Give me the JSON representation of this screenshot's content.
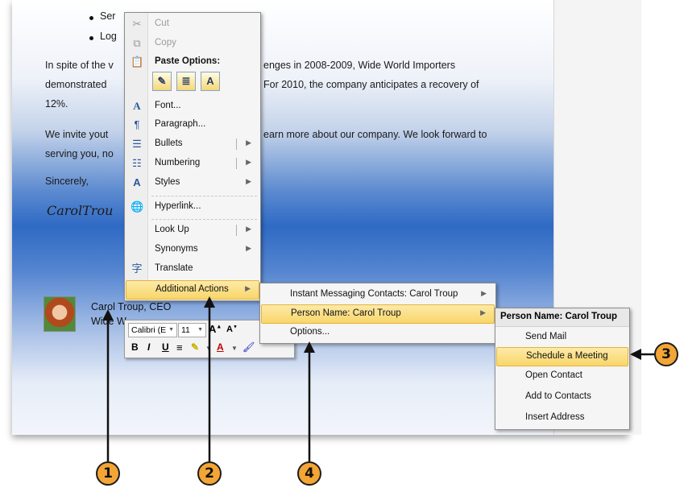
{
  "document": {
    "bullets": [
      "Ser",
      "Log"
    ],
    "para1_line1": "In spite of the v",
    "para1_line1_right": "enges in 2008-2009,  Wide World Importers",
    "para1_line2": "demonstrated",
    "para1_line2_right": "For 2010,  the company anticipates a recovery of",
    "para1_line3": "12%.",
    "para2_line1": "We invite yout",
    "para2_line1_right": "earn more about our company. We look forward to",
    "para2_line2": "serving you, no",
    "closing": "Sincerely,",
    "signature": "CarolTrou",
    "sender_name": "Carol Troup, CEO",
    "sender_company": "Wide W"
  },
  "context_menu": {
    "cut": "Cut",
    "copy": "Copy",
    "paste_options": "Paste Options:",
    "paste_keep_text": "A",
    "font": "Font...",
    "paragraph": "Paragraph...",
    "bullets": "Bullets",
    "numbering": "Numbering",
    "styles": "Styles",
    "hyperlink": "Hyperlink...",
    "look_up": "Look Up",
    "synonyms": "Synonyms",
    "translate": "Translate",
    "additional_actions": "Additional Actions"
  },
  "mini_toolbar": {
    "font_name": "Calibri (E",
    "font_size": "11",
    "grow": "A",
    "shrink": "A",
    "bold": "B",
    "italic": "I",
    "underline": "U",
    "font_color": "A"
  },
  "actions_submenu": {
    "instant_messaging": "Instant Messaging Contacts: Carol Troup",
    "person_name": "Person Name: Carol Troup",
    "options": "Options..."
  },
  "person_submenu": {
    "header": "Person Name: Carol Troup",
    "send_mail": "Send Mail",
    "schedule_meeting": "Schedule a Meeting",
    "open_contact": "Open Contact",
    "add_to_contacts": "Add to Contacts",
    "insert_address": "Insert Address"
  },
  "callouts": [
    "1",
    "2",
    "3",
    "4"
  ],
  "colors": {
    "highlight": "#f9d66a",
    "callout": "#f3a535"
  }
}
